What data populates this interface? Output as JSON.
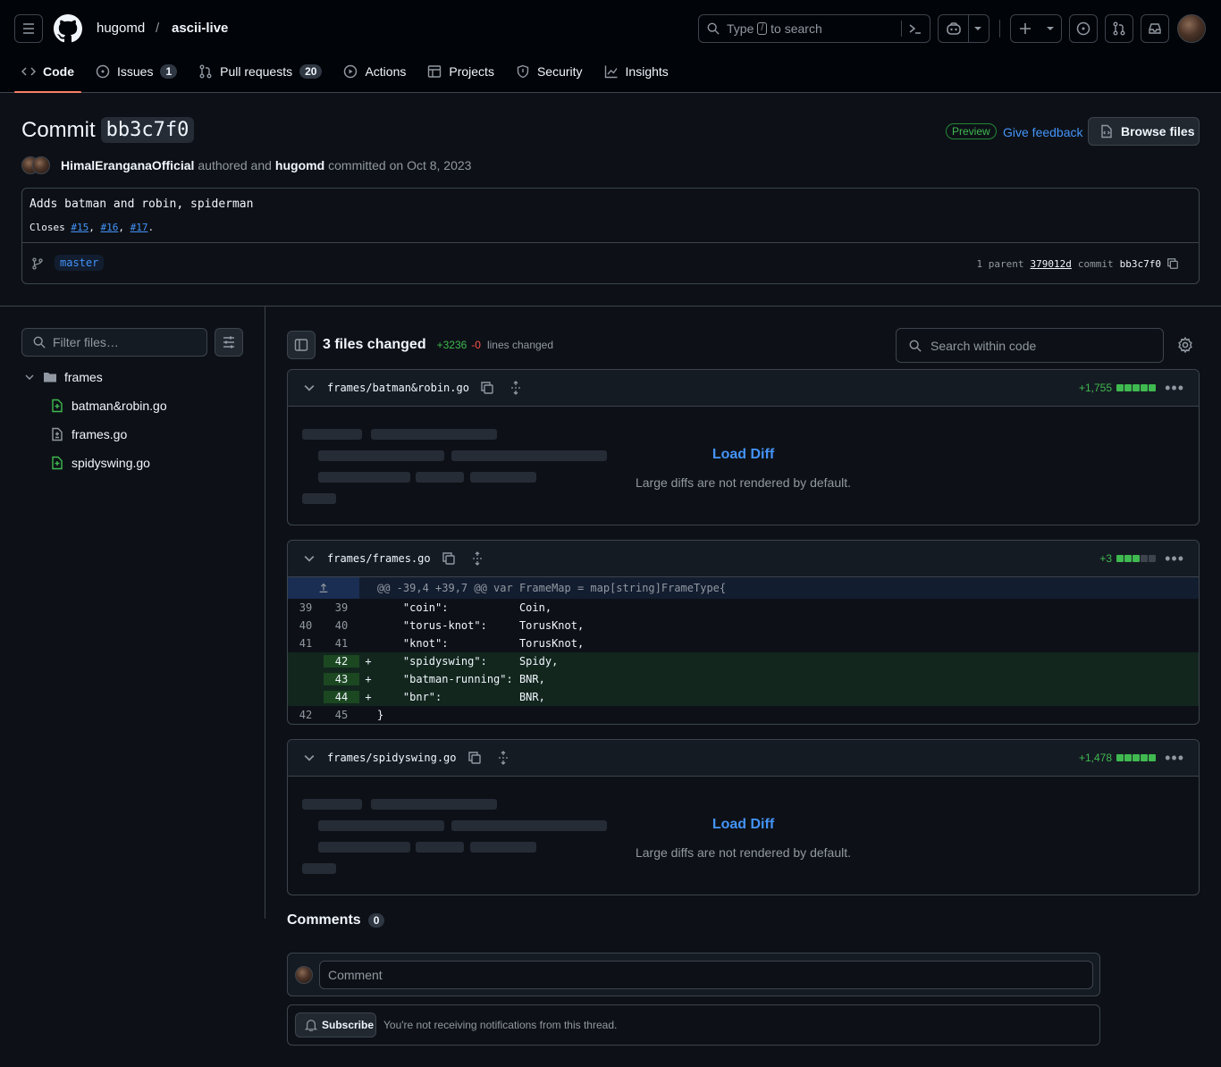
{
  "header": {
    "owner": "hugomd",
    "separator": "/",
    "repo": "ascii-live",
    "search_text_before": "Type",
    "search_key": "/",
    "search_text_after": "to search"
  },
  "tabs": [
    {
      "label": "Code",
      "count": ""
    },
    {
      "label": "Issues",
      "count": "1"
    },
    {
      "label": "Pull requests",
      "count": "20"
    },
    {
      "label": "Actions",
      "count": ""
    },
    {
      "label": "Projects",
      "count": ""
    },
    {
      "label": "Security",
      "count": ""
    },
    {
      "label": "Insights",
      "count": ""
    }
  ],
  "commit": {
    "title_prefix": "Commit",
    "sha": "bb3c7f0",
    "preview": "Preview",
    "feedback": "Give feedback",
    "browse": "Browse files",
    "author": "HimalEranganaOfficial",
    "authored_text": "authored and",
    "committer": "hugomd",
    "committed_text": "committed on Oct 8, 2023",
    "message": "Adds batman and robin, spiderman",
    "closes": "Closes",
    "issues": [
      "#15",
      "#16",
      "#17"
    ],
    "branch": "master",
    "parent_label": "1 parent",
    "parent_sha": "379012d",
    "commit_label": "commit",
    "commit_sha": "bb3c7f0"
  },
  "sidebar": {
    "filter_placeholder": "Filter files…",
    "folder": "frames",
    "files": [
      "batman&robin.go",
      "frames.go",
      "spidyswing.go"
    ]
  },
  "diff": {
    "files_changed": "3 files changed",
    "additions": "+3236",
    "deletions": "-0",
    "lines_changed": "lines changed",
    "search_placeholder": "Search within code",
    "files": [
      {
        "name": "frames/batman&robin.go",
        "stat": "+1,755",
        "load": "Load Diff",
        "note": "Large diffs are not rendered by default."
      },
      {
        "name": "frames/frames.go",
        "stat": "+3",
        "hunk": "@@ -39,4 +39,7 @@ var FrameMap = map[string]FrameType{",
        "lines": [
          {
            "old": "39",
            "new": "39",
            "sign": " ",
            "code": "    \"coin\":           Coin,",
            "type": "ctx"
          },
          {
            "old": "40",
            "new": "40",
            "sign": " ",
            "code": "    \"torus-knot\":     TorusKnot,",
            "type": "ctx"
          },
          {
            "old": "41",
            "new": "41",
            "sign": " ",
            "code": "    \"knot\":           TorusKnot,",
            "type": "ctx"
          },
          {
            "old": "",
            "new": "42",
            "sign": "+",
            "code": "    \"spidyswing\":     Spidy,",
            "type": "add"
          },
          {
            "old": "",
            "new": "43",
            "sign": "+",
            "code": "    \"batman-running\": BNR,",
            "type": "add"
          },
          {
            "old": "",
            "new": "44",
            "sign": "+",
            "code": "    \"bnr\":            BNR,",
            "type": "add"
          },
          {
            "old": "42",
            "new": "45",
            "sign": " ",
            "code": "}",
            "type": "ctx"
          }
        ]
      },
      {
        "name": "frames/spidyswing.go",
        "stat": "+1,478",
        "load": "Load Diff",
        "note": "Large diffs are not rendered by default."
      }
    ]
  },
  "comments": {
    "title": "Comments",
    "count": "0",
    "placeholder": "Comment",
    "subscribe": "Subscribe",
    "notice": "You're not receiving notifications from this thread."
  },
  "colors": {
    "accent": "#4493f8",
    "add": "#3fb950",
    "del": "#f85149",
    "tab_underline": "#f78166"
  }
}
